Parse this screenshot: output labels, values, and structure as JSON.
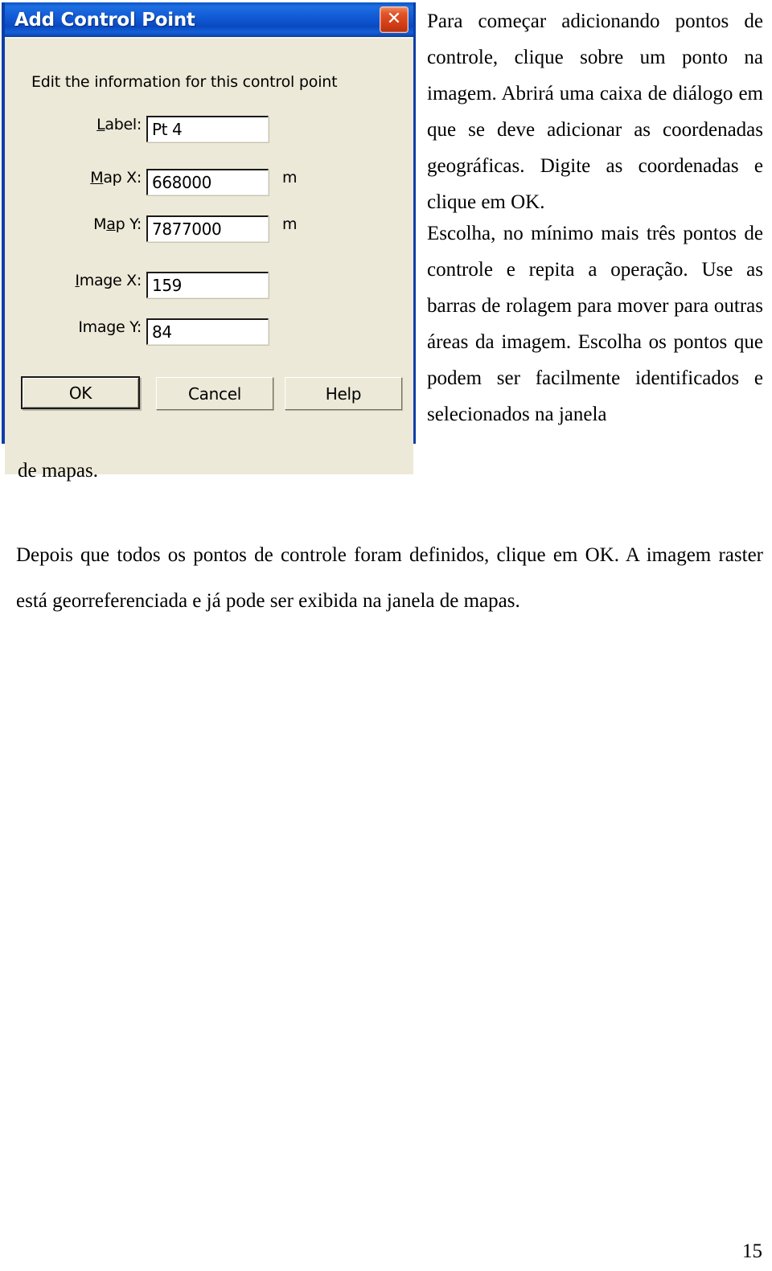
{
  "document": {
    "page_number": "15",
    "paragraphs": {
      "intro": "Para começar adicionando pontos de controle, clique sobre um ponto na imagem. Abrirá uma caixa de diálogo em que se deve adicionar as coordenadas geográficas. Digite as coordenadas e clique em OK.",
      "choose_points": "Escolha, no mínimo mais três pontos de controle e repita a operação. Use as barras de rolagem para mover para outras áreas da imagem. Escolha os pontos que podem ser facilmente identificados e selecionados na janela",
      "orphan_line": "de mapas.",
      "conclusion": "Depois que todos os pontos de controle foram definidos, clique em OK. A imagem raster está georreferenciada e já pode ser exibida na janela de mapas."
    }
  },
  "dialog": {
    "title": "Add Control Point",
    "close_icon": "close-icon",
    "instruction": "Edit the information for this control point",
    "fields": [
      {
        "label_pre": "",
        "label_accel": "L",
        "label_post": "abel:",
        "value": "Pt 4",
        "unit": ""
      },
      {
        "label_pre": "",
        "label_accel": "M",
        "label_post": "ap X:",
        "value": "668000",
        "unit": "m"
      },
      {
        "label_pre": "M",
        "label_accel": "a",
        "label_post": "p Y:",
        "value": "7877000",
        "unit": "m"
      },
      {
        "label_pre": "",
        "label_accel": "I",
        "label_post": "mage X:",
        "value": "159",
        "unit": ""
      },
      {
        "label_pre": "Ima",
        "label_accel": "g",
        "label_post": "e Y:",
        "value": "84",
        "unit": ""
      }
    ],
    "buttons": {
      "ok": "OK",
      "cancel": "Cancel",
      "help": "Help"
    },
    "colors": {
      "titlebar_blue": "#0d55cf",
      "body_beige": "#ece9d8",
      "close_red": "#d03c16",
      "border_blue": "#0b3fa8"
    }
  }
}
